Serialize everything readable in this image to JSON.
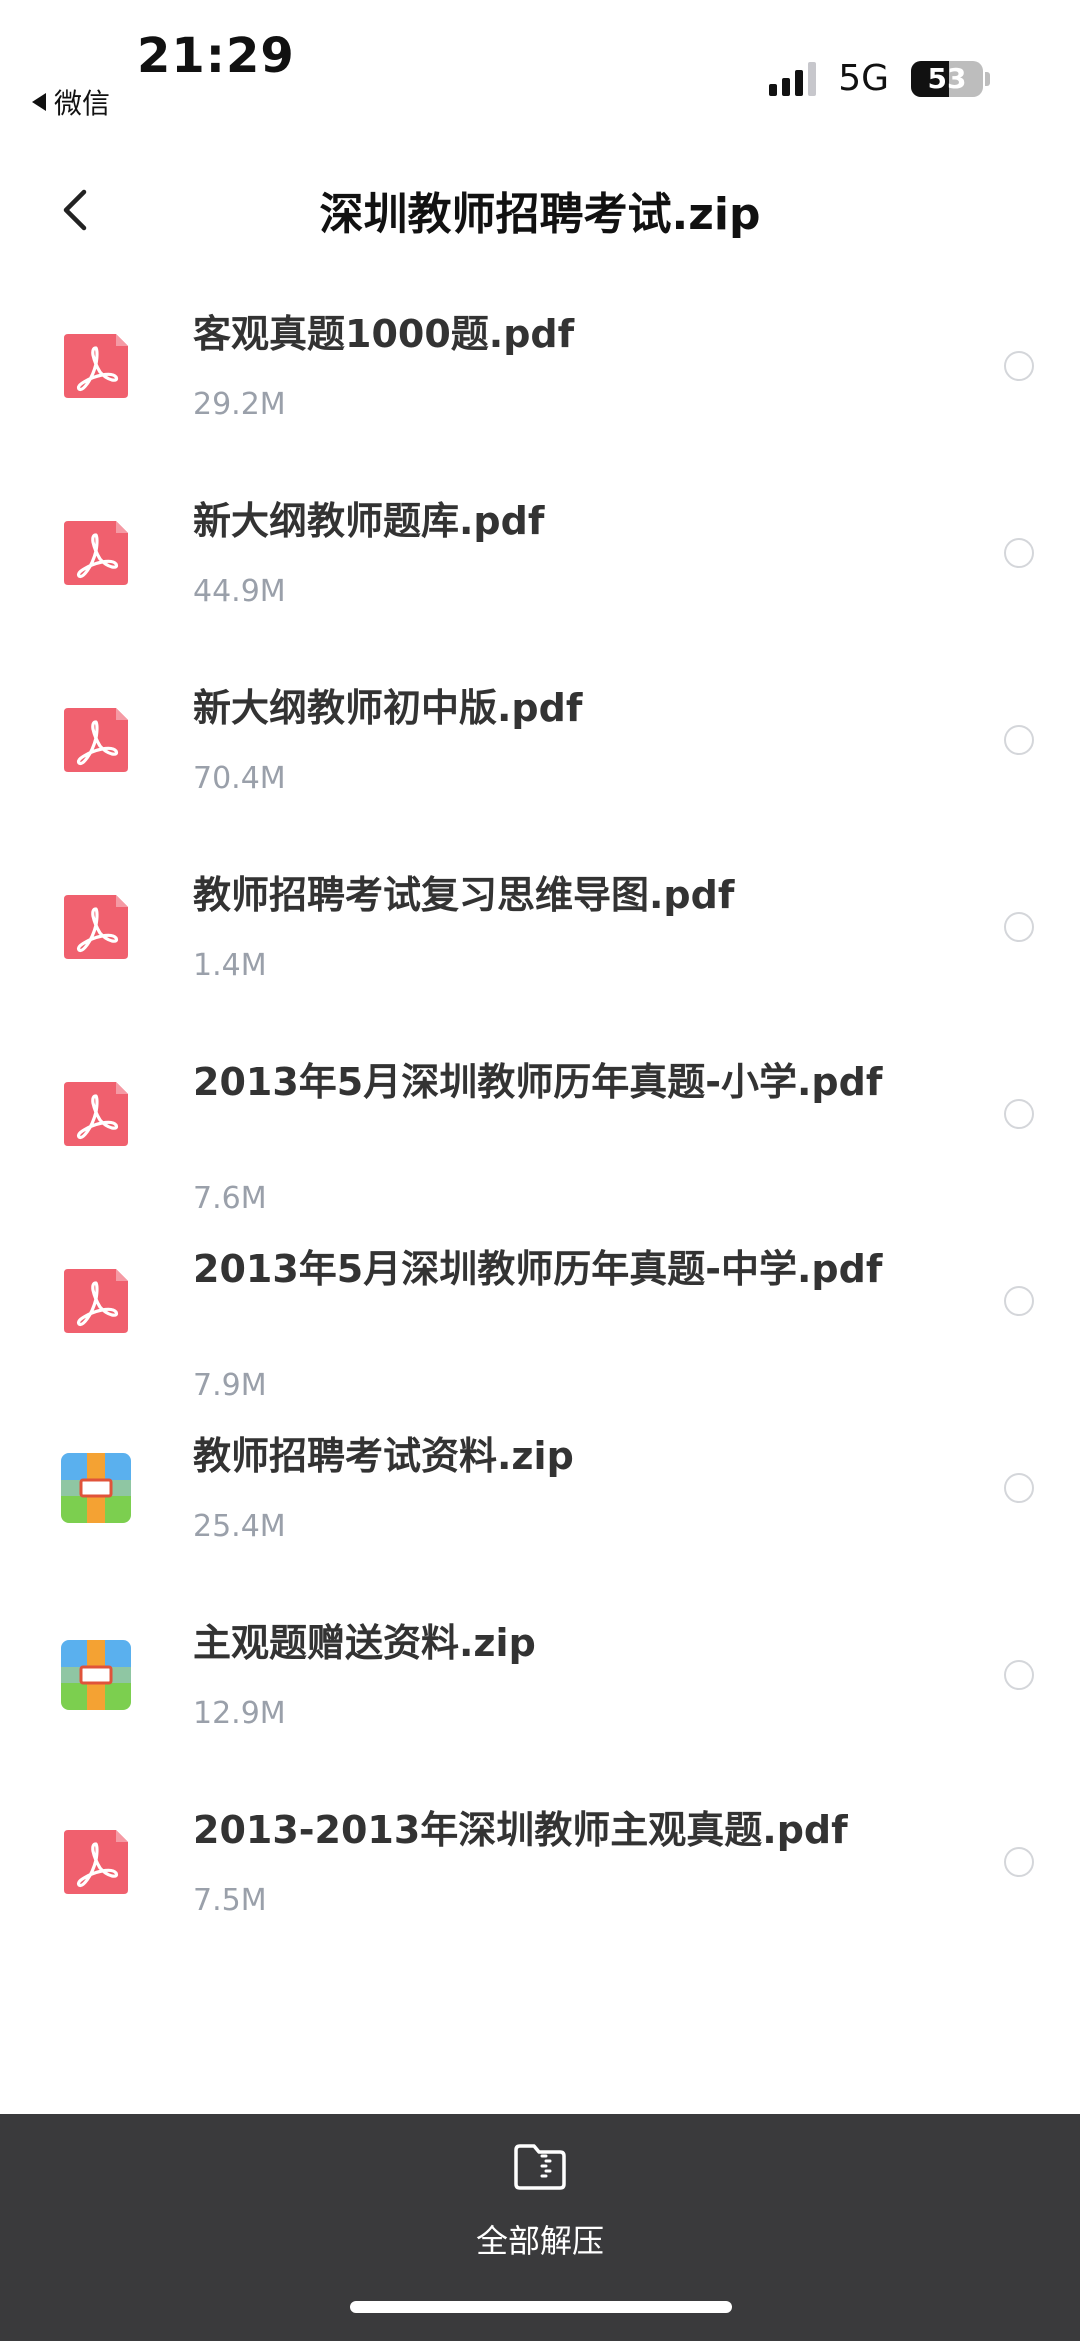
{
  "status_bar": {
    "time": "21:29",
    "back_app": "微信",
    "network": "5G",
    "battery": "53",
    "battery_level_percent": 53
  },
  "nav": {
    "title": "深圳教师招聘考试.zip"
  },
  "files": [
    {
      "name": "客观真题1000题.pdf",
      "size": "29.2M",
      "type": "pdf"
    },
    {
      "name": "新大纲教师题库.pdf",
      "size": "44.9M",
      "type": "pdf"
    },
    {
      "name": "新大纲教师初中版.pdf",
      "size": "70.4M",
      "type": "pdf"
    },
    {
      "name": "教师招聘考试复习思维导图.pdf",
      "size": "1.4M",
      "type": "pdf"
    },
    {
      "name": "2013年5月深圳教师历年真题-小学.pdf",
      "size": "7.6M",
      "type": "pdf"
    },
    {
      "name": "2013年5月深圳教师历年真题-中学.pdf",
      "size": "7.9M",
      "type": "pdf"
    },
    {
      "name": "教师招聘考试资料.zip",
      "size": "25.4M",
      "type": "zip"
    },
    {
      "name": "主观题赠送资料.zip",
      "size": "12.9M",
      "type": "zip"
    },
    {
      "name": "2013-2013年深圳教师主观真题.pdf",
      "size": "7.5M",
      "type": "pdf"
    }
  ],
  "icons": {
    "pdf": "pdf-file-icon",
    "zip": "zip-archive-icon",
    "back": "chevron-left-icon",
    "extract": "folder-zip-icon"
  },
  "colors": {
    "pdf": "#f0606e",
    "zip_blue": "#5ab0ee",
    "zip_green": "#7ccf4f",
    "zip_orange": "#f4a233",
    "bottom_bar": "#3a3a3c"
  },
  "bottom_bar": {
    "extract_label": "全部解压"
  }
}
